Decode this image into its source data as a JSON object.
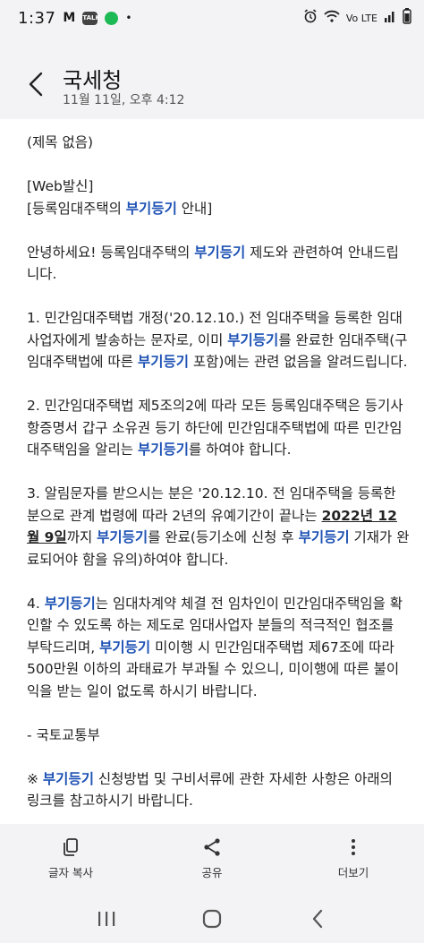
{
  "status_bar": {
    "time": "1:37",
    "left_glyph": "M",
    "talk_icon_text": "TALK",
    "dot": "•",
    "network": "Vo LTE"
  },
  "header": {
    "title": "국세청",
    "date": "11월 11일, 오후 4:12"
  },
  "message": {
    "paragraphs": [
      {
        "segments": [
          {
            "text": "(제목 없음)",
            "style": "plain"
          }
        ]
      },
      {
        "segments": [
          {
            "text": "[Web발신]\n[등록임대주택의 ",
            "style": "plain"
          },
          {
            "text": "부기등기",
            "style": "highlight"
          },
          {
            "text": " 안내]",
            "style": "plain"
          }
        ]
      },
      {
        "segments": [
          {
            "text": "안녕하세요! 등록임대주택의 ",
            "style": "plain"
          },
          {
            "text": "부기등기",
            "style": "highlight"
          },
          {
            "text": " 제도와 관련하여 안내드립니다.",
            "style": "plain"
          }
        ]
      },
      {
        "segments": [
          {
            "text": "1. 민간임대주택법 개정('20.12.10.) 전 임대주택을 등록한 임대사업자에게 발송하는 문자로, 이미 ",
            "style": "plain"
          },
          {
            "text": "부기등기",
            "style": "highlight"
          },
          {
            "text": "를 완료한 임대주택(구 임대주택법에 따른 ",
            "style": "plain"
          },
          {
            "text": "부기등기",
            "style": "highlight"
          },
          {
            "text": " 포함)에는 관련 없음을 알려드립니다.",
            "style": "plain"
          }
        ]
      },
      {
        "segments": [
          {
            "text": "2. 민간임대주택법 제5조의2에 따라 모든 등록임대주택은 등기사항증명서 갑구 소유권 등기 하단에 민간임대주택법에 따른 민간임대주택임을 알리는 ",
            "style": "plain"
          },
          {
            "text": "부기등기",
            "style": "highlight"
          },
          {
            "text": "를 하여야 합니다.",
            "style": "plain"
          }
        ]
      },
      {
        "segments": [
          {
            "text": "3. 알림문자를 받으시는 분은 '20.12.10. 전 임대주택을 등록한 분으로 관계 법령에 따라 2년의 유예기간이 끝나는 ",
            "style": "plain"
          },
          {
            "text": "2022년 12월 9일",
            "style": "underline"
          },
          {
            "text": "까지 ",
            "style": "plain"
          },
          {
            "text": "부기등기",
            "style": "highlight"
          },
          {
            "text": "를 완료(등기소에 신청 후 ",
            "style": "plain"
          },
          {
            "text": "부기등기",
            "style": "highlight"
          },
          {
            "text": " 기재가 완료되어야 함을 유의)하여야 합니다.",
            "style": "plain"
          }
        ]
      },
      {
        "segments": [
          {
            "text": "4. ",
            "style": "plain"
          },
          {
            "text": "부기등기",
            "style": "highlight"
          },
          {
            "text": "는 임대차계약 체결 전 임차인이 민간임대주택임을 확인할 수 있도록 하는 제도로 임대사업자 분들의 적극적인 협조를 부탁드리며, ",
            "style": "plain"
          },
          {
            "text": "부기등기",
            "style": "highlight"
          },
          {
            "text": " 미이행 시 민간임대주택법 제67조에 따라 500만원 이하의 과태료가 부과될 수 있으니, 미이행에 따른 불이익을 받는 일이 없도록 하시기 바랍니다.",
            "style": "plain"
          }
        ]
      },
      {
        "segments": [
          {
            "text": "- 국토교통부",
            "style": "plain"
          }
        ]
      },
      {
        "segments": [
          {
            "text": "※ ",
            "style": "plain"
          },
          {
            "text": "부기등기",
            "style": "highlight"
          },
          {
            "text": " 신청방법 및 구비서류에 관한 자세한 사항은 아래의 링크를 참고하시기 바랍니다.",
            "style": "plain"
          }
        ]
      }
    ]
  },
  "actions": [
    {
      "label": "글자 복사",
      "icon": "copy-icon"
    },
    {
      "label": "공유",
      "icon": "share-icon"
    },
    {
      "label": "더보기",
      "icon": "more-icon"
    }
  ],
  "colors": {
    "highlight": "#1e52b4",
    "background": "#f3f3f5"
  }
}
